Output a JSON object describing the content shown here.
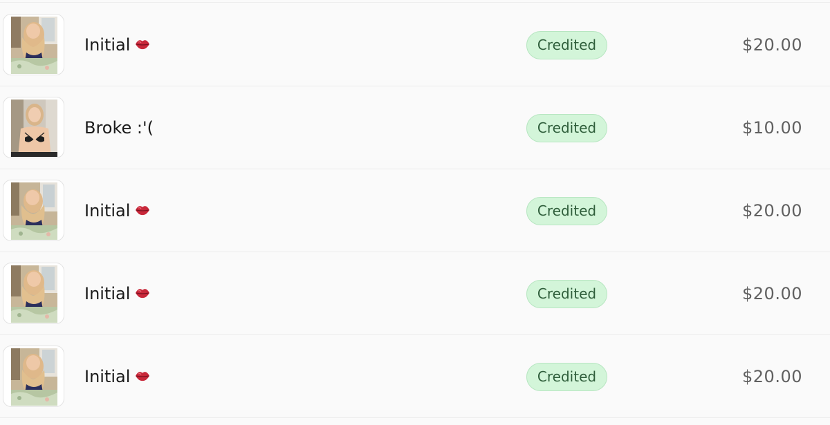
{
  "transactions": [
    {
      "title": "Initial",
      "has_emoji": true,
      "emoji_icon": "lips-icon",
      "status": "Credited",
      "amount": "$20.00",
      "thumb": "a"
    },
    {
      "title": "Broke :'(",
      "has_emoji": false,
      "status": "Credited",
      "amount": "$10.00",
      "thumb": "b"
    },
    {
      "title": "Initial",
      "has_emoji": true,
      "emoji_icon": "lips-icon",
      "status": "Credited",
      "amount": "$20.00",
      "thumb": "a"
    },
    {
      "title": "Initial",
      "has_emoji": true,
      "emoji_icon": "lips-icon",
      "status": "Credited",
      "amount": "$20.00",
      "thumb": "a"
    },
    {
      "title": "Initial",
      "has_emoji": true,
      "emoji_icon": "lips-icon",
      "status": "Credited",
      "amount": "$20.00",
      "thumb": "a"
    }
  ],
  "colors": {
    "badge_bg": "#d3f5d9",
    "badge_text": "#2f5e3b",
    "amount_text": "#606060"
  }
}
